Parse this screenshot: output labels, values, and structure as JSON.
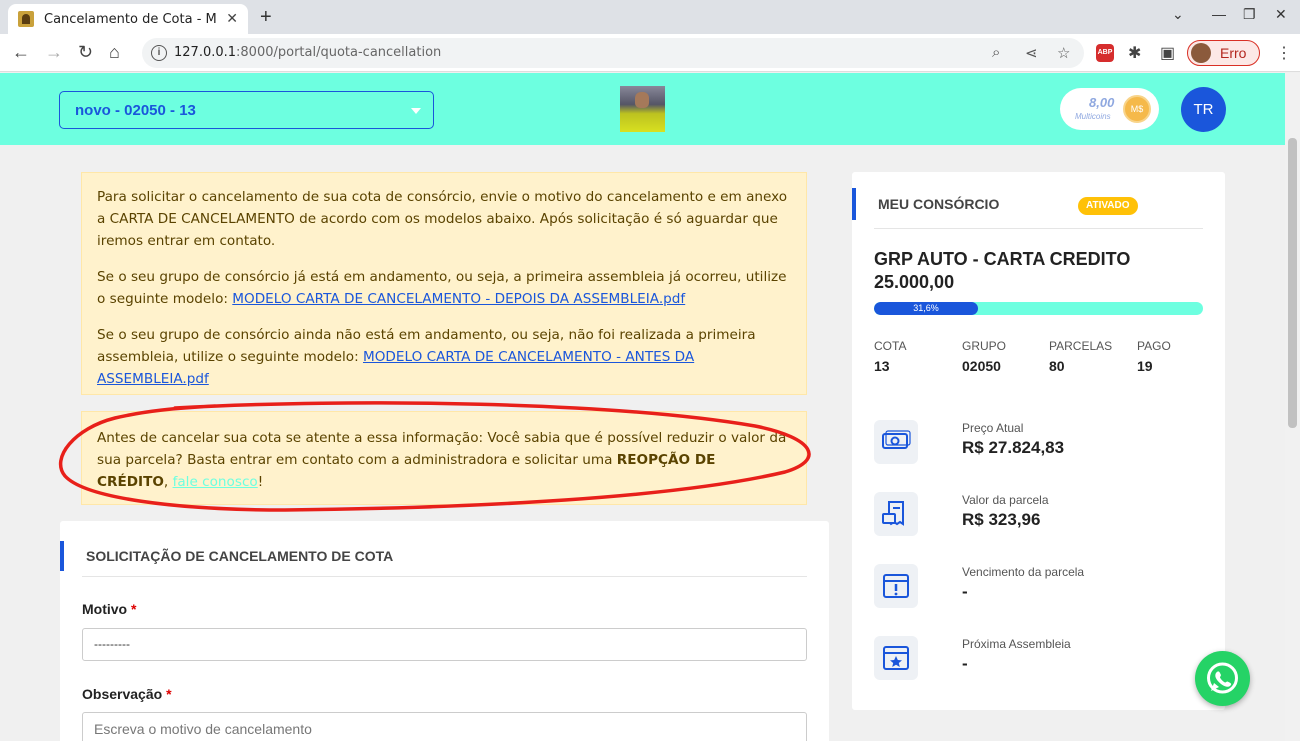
{
  "browser": {
    "tab_title": "Cancelamento de Cota - M",
    "url_host": "127.0.0.1",
    "url_path": ":8000/portal/quota-cancellation",
    "profile_label": "Erro"
  },
  "header": {
    "quota_select_value": "novo - 02050 - 13",
    "coins_value": "8,00",
    "coins_label": "Multicoins",
    "coins_badge": "M$",
    "user_initials": "TR"
  },
  "notices": {
    "intro": "Para solicitar o cancelamento de sua cota de consórcio, envie o motivo do cancelamento e em anexo a CARTA DE CANCELAMENTO de acordo com os modelos abaixo. Após solicitação é só aguardar que iremos entrar em contato.",
    "after_text": "Se o seu grupo de consórcio já está em andamento, ou seja, a primeira assembleia já ocorreu, utilize o seguinte modelo: ",
    "after_link": "MODELO CARTA DE CANCELAMENTO - DEPOIS DA ASSEMBLEIA.pdf",
    "before_text": "Se o seu grupo de consórcio ainda não está em andamento, ou seja, não foi realizada a primeira assembleia, utilize o seguinte modelo: ",
    "before_link": "MODELO CARTA DE CANCELAMENTO - ANTES DA ASSEMBLEIA.pdf",
    "warning_text": "Antes de cancelar sua cota se atente a essa informação: Você sabia que é possível reduzir o valor da sua parcela? Basta entrar em contato com a administradora e solicitar uma ",
    "warning_bold": "REOPÇÃO DE CRÉDITO",
    "warning_sep": ", ",
    "warning_link": "fale conosco",
    "warning_end": "!"
  },
  "form": {
    "title": "SOLICITAÇÃO DE CANCELAMENTO DE COTA",
    "motivo_label": "Motivo",
    "motivo_value": "---------",
    "observacao_label": "Observação",
    "observacao_placeholder": "Escreva o motivo de cancelamento",
    "required_mark": "*"
  },
  "consorcio": {
    "title": "MEU CONSÓRCIO",
    "status": "ATIVADO",
    "plan_name": "GRP AUTO - CARTA CREDITO 25.000,00",
    "progress": 0.316,
    "progress_label": "31,6%",
    "stats": [
      {
        "label": "COTA",
        "value": "13"
      },
      {
        "label": "GRUPO",
        "value": "02050"
      },
      {
        "label": "PARCELAS",
        "value": "80"
      },
      {
        "label": "PAGO",
        "value": "19"
      }
    ],
    "info": [
      {
        "label": "Preço Atual",
        "value": "R$ 27.824,83",
        "icon": "money-icon"
      },
      {
        "label": "Valor da parcela",
        "value": "R$ 323,96",
        "icon": "invoice-icon"
      },
      {
        "label": "Vencimento da parcela",
        "value": "-",
        "icon": "calendar-alert-icon"
      },
      {
        "label": "Próxima Assembleia",
        "value": "-",
        "icon": "calendar-star-icon"
      }
    ]
  },
  "colors": {
    "accent": "#1a56db",
    "header_bg": "#6dffe0",
    "notice_bg": "#fff2cc",
    "badge": "#ffc107",
    "whatsapp": "#25d366"
  }
}
